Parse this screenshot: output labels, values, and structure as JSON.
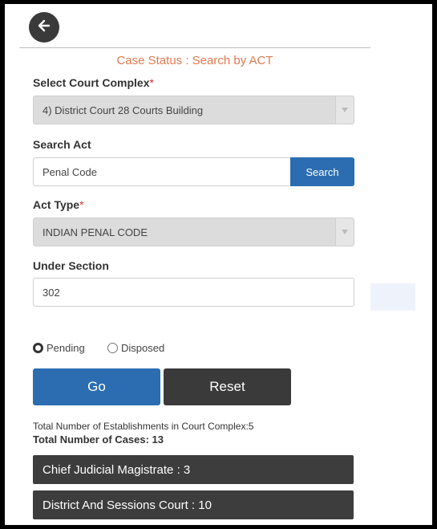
{
  "header": {
    "back_icon": "arrow-left-icon",
    "title": "Case Status : Search by ACT"
  },
  "court_complex": {
    "label": "Select Court Complex",
    "required_mark": "*",
    "selected": "4) District Court 28 Courts Building"
  },
  "search_act": {
    "label": "Search Act",
    "value": "Penal Code",
    "button": "Search"
  },
  "act_type": {
    "label": "Act Type",
    "required_mark": "*",
    "selected": "INDIAN PENAL CODE"
  },
  "under_section": {
    "label": "Under Section",
    "value": "302"
  },
  "status": {
    "options": [
      "Pending",
      "Disposed"
    ],
    "selected": "Pending"
  },
  "actions": {
    "go": "Go",
    "reset": "Reset"
  },
  "results": {
    "establishments": "Total Number of Establishments in Court Complex:5",
    "total_cases": "Total Number of Cases: 13",
    "courts": [
      "Chief Judicial Magistrate : 3",
      "District And Sessions Court : 10"
    ]
  },
  "colors": {
    "accent_blue": "#2b6db0",
    "title_orange": "#e07a50",
    "dark": "#3a3a3a"
  }
}
